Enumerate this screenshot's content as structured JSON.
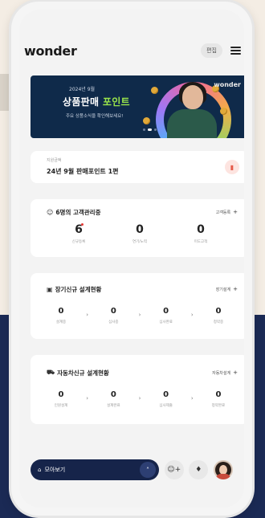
{
  "app": {
    "logo": "wonder",
    "edit_label": "편집"
  },
  "banner": {
    "subtitle": "2024년 9월",
    "title_main": "상품판매",
    "title_highlight": "포인트",
    "description": "주요 상품소식을 확인해보세요!",
    "brand": "wonder",
    "current_slide": 2,
    "slide_count": 3
  },
  "points": {
    "small_label": "지원금액",
    "title": "24년 9월 판매포인트 1편"
  },
  "customers": {
    "title": "6명의 고객관리중",
    "link": "고객등록",
    "stats": [
      {
        "value": "6",
        "label": "신규등록",
        "dot": true
      },
      {
        "value": "0",
        "label": "연기/노력"
      },
      {
        "value": "0",
        "label": "미도고객"
      }
    ]
  },
  "ltc": {
    "title": "장기신규 설계현황",
    "link": "장기설계",
    "stats": [
      {
        "value": "0",
        "label": "설계중"
      },
      {
        "value": "0",
        "label": "심사중"
      },
      {
        "value": "0",
        "label": "심사완료"
      },
      {
        "value": "0",
        "label": "청약중"
      }
    ]
  },
  "auto": {
    "title": "자동차신규 설계현황",
    "link": "자동차설계",
    "stats": [
      {
        "value": "0",
        "label": "인원설계"
      },
      {
        "value": "0",
        "label": "설계완료"
      },
      {
        "value": "0",
        "label": "심사제출"
      },
      {
        "value": "0",
        "label": "청약완료"
      }
    ]
  },
  "bottom": {
    "view_all_label": "모아보기"
  },
  "colors": {
    "navy": "#16244a",
    "banner_bg": "#0f2a4a",
    "highlight_green": "#9be64b",
    "alert_red": "#e53935"
  }
}
